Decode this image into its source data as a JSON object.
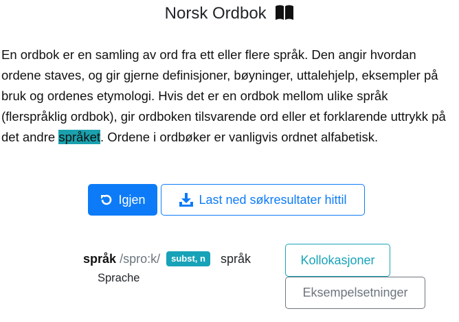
{
  "header": {
    "title": "Norsk Ordbok",
    "icon": "open-book-icon"
  },
  "intro": {
    "before": "En ordbok er en samling av ord fra ett eller flere språk. Den angir hvordan ordene staves, og gir gjerne definisjoner, bøyninger, uttalehjelp, eksempler på bruk og ordenes etymologi. Hvis det er en ordbok mellom ulike språk (flerspråklig ordbok), gir ordboken tilsvarende ord eller et forklarende uttrykk på det andre ",
    "highlight": "språket",
    "after": ". Ordene i ordbøker er vanligvis ordnet alfabetisk.",
    "highlight_color": "#1aa1ad"
  },
  "actions": {
    "again_label": "Igjen",
    "download_label": "Last ned søkresultater hittil",
    "primary_color": "#0d7bf7"
  },
  "entry": {
    "word": "språk",
    "pronunciation": "/spro:k/",
    "badge": "subst, n",
    "gloss": "språk",
    "translation": "Sprache",
    "collocations_label": "Kollokasjoner",
    "examples_label": "Eksempelsetninger",
    "badge_color": "#17a2b8"
  }
}
